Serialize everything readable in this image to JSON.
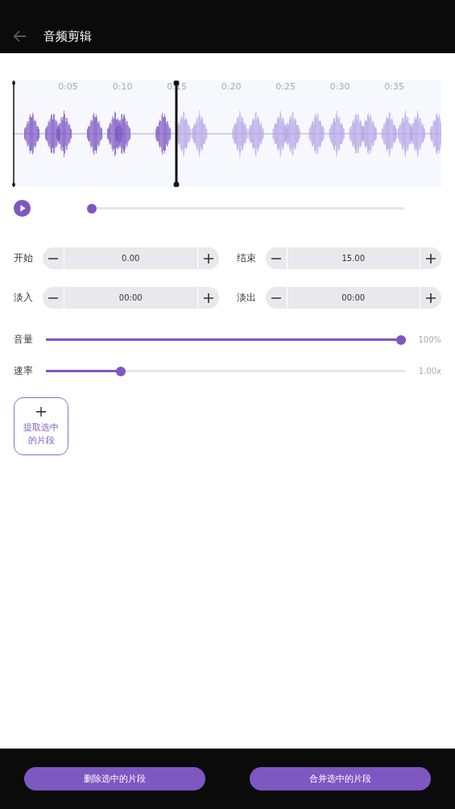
{
  "app_bar": {
    "title": "音频剪辑"
  },
  "waveform": {
    "ticks": [
      "0:05",
      "0:10",
      "0:15",
      "0:20",
      "0:25",
      "0:30",
      "0:35"
    ]
  },
  "player": {
    "level": 0
  },
  "params": [
    {
      "label": "开始",
      "value": "0.00"
    },
    {
      "label": "结束",
      "value": "15.00"
    },
    {
      "label": "淡入",
      "value": "00:00"
    },
    {
      "label": "淡出",
      "value": "00:00"
    }
  ],
  "sliders": [
    {
      "label": "音量",
      "level": 1,
      "reading": "100%"
    },
    {
      "label": "速率",
      "level": 0.2,
      "reading": "1.00x"
    }
  ],
  "extract_button": {
    "label": "提取选中的片段"
  },
  "bottom_buttons": [
    "删除选中的片段",
    "合并选中的片段"
  ]
}
